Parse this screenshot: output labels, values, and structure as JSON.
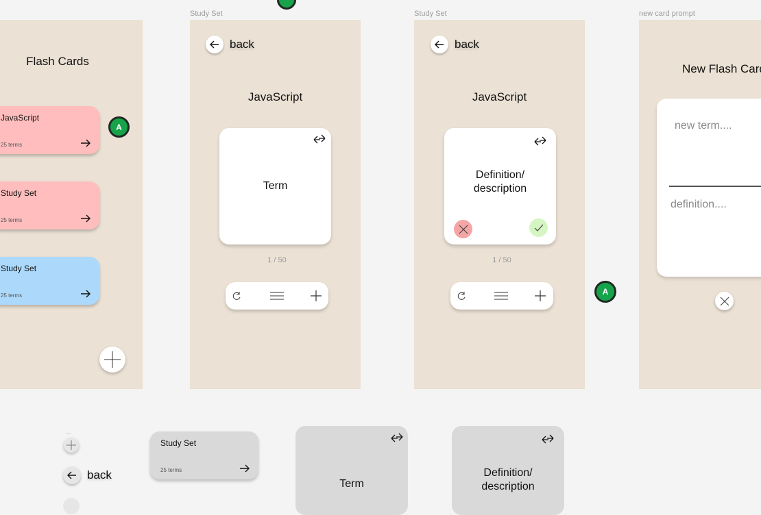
{
  "frames": {
    "home": {
      "title": "Flash Cards",
      "decks": [
        {
          "name": "JavaScript",
          "count": "25 terms",
          "color": "#ffbdbd"
        },
        {
          "name": "Study Set",
          "count": "25 terms",
          "color": "#ffbdbd"
        },
        {
          "name": "Study Set",
          "count": "25 terms",
          "color": "#acd9fb"
        }
      ]
    },
    "study_front": {
      "label": "Study Set",
      "back": "back",
      "title": "JavaScript",
      "card_text": "Term",
      "pager": "1 / 50"
    },
    "study_back": {
      "label": "Study Set",
      "back": "back",
      "title": "JavaScript",
      "card_text": "Definition/\ndescription",
      "pager": "1 / 50"
    },
    "new_card": {
      "label": "new card prompt",
      "title": "New Flash Card",
      "term_placeholder": "new term....",
      "definition_placeholder": "definition...."
    }
  },
  "avatars": {
    "letter": "A"
  },
  "components": {
    "dots": "...",
    "back": "back",
    "deck": {
      "name": "Study Set",
      "count": "25 terms"
    },
    "term_card": "Term",
    "definition_card": "Definition/\ndescription"
  },
  "icons": {
    "flip": "flip-arrows-icon",
    "arrow": "arrow-right-icon",
    "back": "arrow-left-icon",
    "shuffle": "shuffle-icon",
    "menu": "menu-icon",
    "plus": "plus-icon",
    "wrong": "x-icon",
    "right": "check-icon",
    "close": "close-icon"
  },
  "colors": {
    "frame": "#ebe1d4",
    "pink": "#ffbdbd",
    "blue": "#acd9fb",
    "avatar": "#17a34a",
    "wrong": "#f4a5a5",
    "right": "#d5f5c3"
  }
}
